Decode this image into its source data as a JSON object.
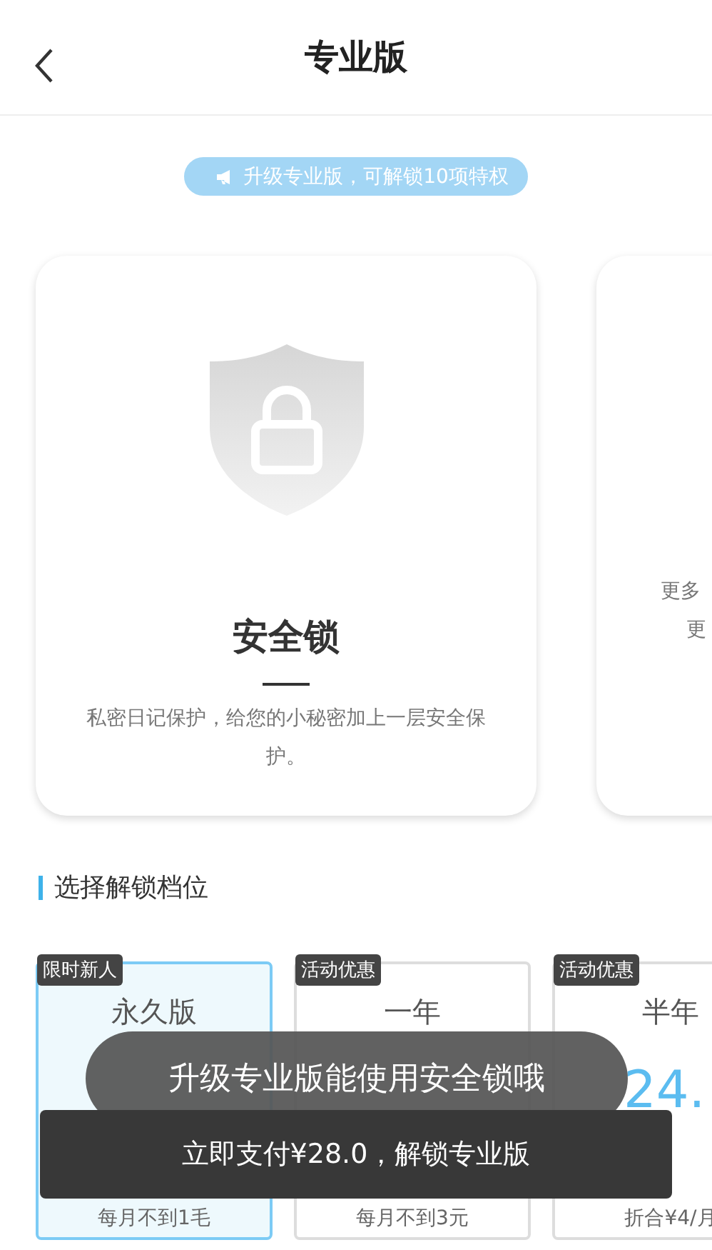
{
  "header": {
    "title": "专业版"
  },
  "banner": {
    "text": "升级专业版，可解锁10项特权"
  },
  "features": [
    {
      "kind": "full",
      "title": "安全锁",
      "lines": [
        "私密日记保护，给您的小秘密加上一层安全保护。"
      ]
    },
    {
      "kind": "cut",
      "lines": [
        "更多",
        "更"
      ]
    }
  ],
  "section_title": "选择解锁档位",
  "plans": [
    {
      "tag": "限时新人",
      "name": "永久版",
      "note": "每月不到1毛",
      "selected": true
    },
    {
      "tag": "活动优惠",
      "name": "一年",
      "note": "每月不到3元",
      "selected": false
    },
    {
      "tag": "活动优惠",
      "name": "半年",
      "price": "24.",
      "note": "折合¥4/月",
      "selected": false
    }
  ],
  "toast": "升级专业版能使用安全锁哦",
  "pay_button": "立即支付¥28.0，解锁专业版"
}
